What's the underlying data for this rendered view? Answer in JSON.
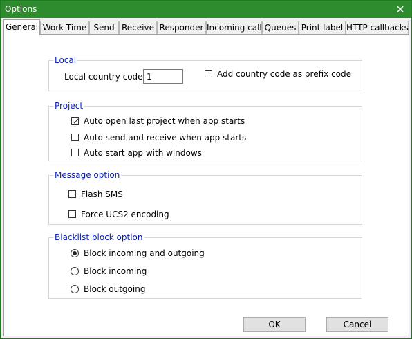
{
  "window": {
    "title": "Options"
  },
  "tabs": [
    {
      "label": "General"
    },
    {
      "label": "Work Time"
    },
    {
      "label": "Send"
    },
    {
      "label": "Receive"
    },
    {
      "label": "Responder"
    },
    {
      "label": "Incoming call"
    },
    {
      "label": "Queues"
    },
    {
      "label": "Print label"
    },
    {
      "label": "HTTP callbacks"
    }
  ],
  "local": {
    "legend": "Local",
    "country_code_label": "Local country code",
    "country_code_value": "1",
    "prefix_label": "Add country code as prefix code",
    "prefix_checked": false
  },
  "project": {
    "legend": "Project",
    "auto_open_label": "Auto open last project when app starts",
    "auto_open_checked": true,
    "auto_send_label": "Auto send and receive when app starts",
    "auto_send_checked": false,
    "auto_start_label": "Auto start app with windows",
    "auto_start_checked": false
  },
  "message": {
    "legend": "Message option",
    "flash_label": "Flash SMS",
    "flash_checked": false,
    "ucs2_label": "Force UCS2 encoding",
    "ucs2_checked": false
  },
  "blacklist": {
    "legend": "Blacklist block option",
    "both_label": "Block incoming and outgoing",
    "incoming_label": "Block incoming",
    "outgoing_label": "Block outgoing",
    "selected": "both"
  },
  "buttons": {
    "ok": "OK",
    "cancel": "Cancel"
  },
  "colors": {
    "titlebar": "#2e8b2e",
    "legend_text": "#0a1fb0"
  },
  "icons": {
    "close": "close-icon"
  }
}
